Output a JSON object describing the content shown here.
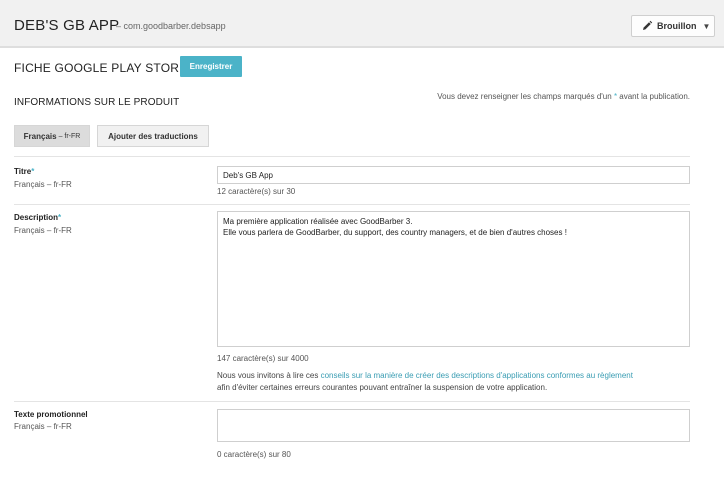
{
  "header": {
    "app_title": "DEB'S GB APP",
    "package_name": "– com.goodbarber.debsapp",
    "status_label": "Brouillon",
    "status_caret": "▼"
  },
  "listing": {
    "title": "FICHE GOOGLE PLAY STORE",
    "save_label": "Enregistrer"
  },
  "product_info": {
    "title": "INFORMATIONS SUR LE PRODUIT",
    "required_note_before": "Vous devez renseigner les champs marqués d'un ",
    "required_star": "*",
    "required_note_after": " avant la publication."
  },
  "language_tabs": {
    "active_label": "Français",
    "active_code": "– fr-FR",
    "add_label": "Ajouter des traductions"
  },
  "fields": {
    "title_field": {
      "label": "Titre",
      "required": "*",
      "language": "Français – fr-FR",
      "value": "Deb's GB App",
      "counter": "12 caractère(s) sur 30"
    },
    "description_field": {
      "label": "Description",
      "required": "*",
      "language": "Français – fr-FR",
      "lines": [
        "Ma première application réalisée avec GoodBarber 3.",
        "Elle vous parlera de GoodBarber, du support, des country managers, et de bien d'autres choses !"
      ],
      "counter": "147 caractère(s) sur 4000",
      "help_before": "Nous vous invitons à lire ces ",
      "help_link": "conseils sur la manière de créer des descriptions d'applications conformes au règlement",
      "help_after": "afin d'éviter certaines erreurs courantes pouvant entraîner la suspension de votre application."
    },
    "promo_field": {
      "label": "Texte promotionnel",
      "language": "Français – fr-FR",
      "value": "",
      "counter": "0 caractère(s) sur 80"
    }
  },
  "colors": {
    "accent": "#4bb3c8",
    "link": "#3a9db3",
    "header_bg": "#f1f1f1"
  },
  "icons": {
    "status_button": "pencil-icon",
    "status_dropdown": "caret-down-icon"
  }
}
